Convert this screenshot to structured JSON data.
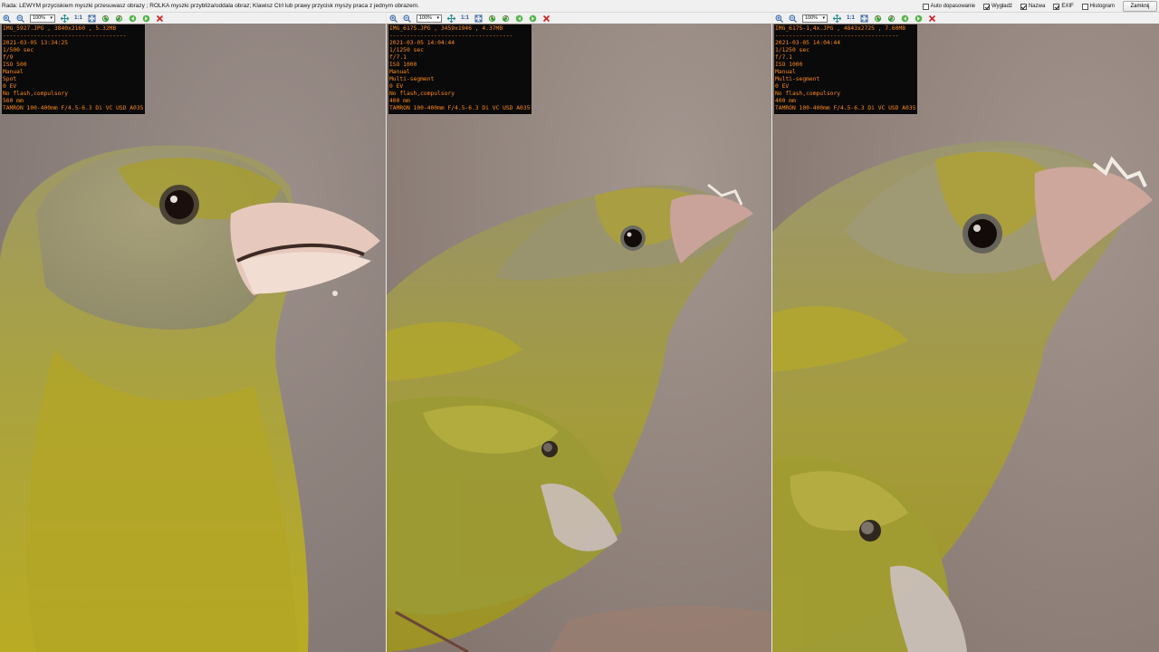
{
  "hint": "Rada: LEWYM przyciskiem myszki przesuwasz obrazy ; ROLKA myszki przybliża/oddala obraz; Klawisz Ctrl lub prawy przycisk myszy praca z jednym obrazem.",
  "options": [
    {
      "label": "Auto dopasowanie",
      "checked": false
    },
    {
      "label": "Wygładź",
      "checked": true
    },
    {
      "label": "Nazwa",
      "checked": true
    },
    {
      "label": "EXIF",
      "checked": true
    },
    {
      "label": "Histogram",
      "checked": false
    }
  ],
  "close_label": "Zamknij",
  "toolbar": {
    "zoom_value": "100%",
    "ratio_label": "1:1"
  },
  "panels": [
    {
      "header": "IMG_5927.JPG , 3840x2160 , 5.32MB",
      "separator": "------------------------------------",
      "exif": [
        "2021-03-05 13:34:25",
        "1/500 sec",
        "f/9",
        "ISO 500",
        "Manual",
        "Spot",
        "0 EV",
        "No flash,compulsory",
        "560 mm",
        "TAMRON 100-400mm F/4.5-6.3 Di VC USD A035"
      ]
    },
    {
      "header": "IMG_6175.JPG , 3459x1946 , 4.37MB",
      "separator": "------------------------------------",
      "exif": [
        "2021-03-05 14:04:44",
        "1/1250 sec",
        "f/7.1",
        "ISO 1000",
        "Manual",
        "Multi-segment",
        "0 EV",
        "No flash,compulsory",
        "400 mm",
        "TAMRON 100-400mm F/4.5-6.3 Di VC USD A035"
      ]
    },
    {
      "header": "IMG_6175-1,4x.JPG , 4843x2725 , 7.60MB",
      "separator": "------------------------------------",
      "exif": [
        "2021-03-05 14:04:44",
        "1/1250 sec",
        "f/7.1",
        "ISO 1000",
        "Manual",
        "Multi-segment",
        "0 EV",
        "No flash,compulsory",
        "400 mm",
        "TAMRON 100-400mm F/4.5-6.3 Di VC USD A035"
      ]
    }
  ],
  "icons": [
    "zoom-in-icon",
    "zoom-out-icon",
    "zoom-dropdown",
    "fit-icon",
    "ratio-1-1",
    "fullscreen-icon",
    "rotate-left-icon",
    "rotate-right-icon",
    "prev-icon",
    "next-icon",
    "close-icon"
  ],
  "colors": {
    "exif_text": "#ff8a1a",
    "exif_bg": "#0a0a0a",
    "background": "#8d817c",
    "bird_yellow": "#b9ad2a"
  }
}
